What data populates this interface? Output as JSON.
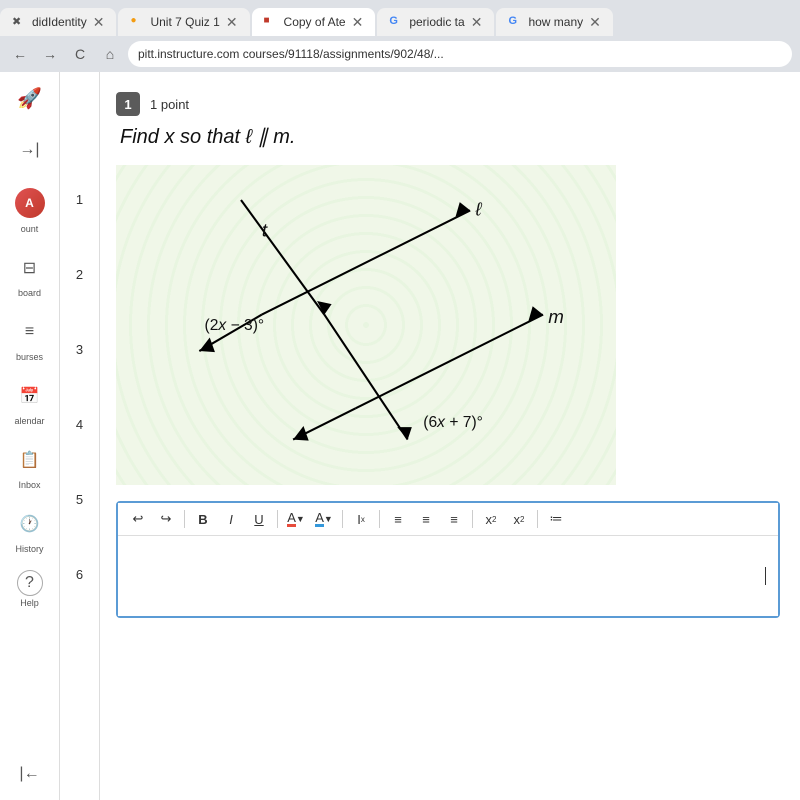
{
  "browser": {
    "tabs": [
      {
        "id": "tab1",
        "label": "didIdentity",
        "favicon_color": "#e74c3c",
        "active": false,
        "favicon": "✖"
      },
      {
        "id": "tab2",
        "label": "Unit 7 Quiz 1",
        "favicon_color": "#f39c12",
        "active": false,
        "favicon": "🟠"
      },
      {
        "id": "tab3",
        "label": "Copy of Ate",
        "favicon_color": "#c0392b",
        "active": true,
        "favicon": "🔴"
      },
      {
        "id": "tab4",
        "label": "periodic ta",
        "favicon_color": "#4285f4",
        "active": false,
        "favicon": "G"
      },
      {
        "id": "tab5",
        "label": "how many",
        "favicon_color": "#4285f4",
        "active": false,
        "favicon": "G"
      }
    ],
    "address": "pitt.instructure.com courses/91118/assignments/902/48/...",
    "nav_back": "←",
    "nav_forward": "→",
    "nav_refresh": "C",
    "nav_home": "⌂"
  },
  "sidebar": {
    "items": [
      {
        "id": "rocket",
        "icon": "🚀",
        "label": ""
      },
      {
        "id": "collapse",
        "icon": "→|",
        "label": ""
      },
      {
        "id": "account",
        "icon": "👤",
        "label": "ount"
      },
      {
        "id": "dashboard",
        "icon": "⊞",
        "label": "board"
      },
      {
        "id": "courses",
        "icon": "≡",
        "label": "burses"
      },
      {
        "id": "calendar",
        "icon": "📅",
        "label": "alendar"
      },
      {
        "id": "inbox",
        "icon": "📋",
        "label": "Inbox"
      },
      {
        "id": "history",
        "icon": "🕐",
        "label": "History"
      },
      {
        "id": "help",
        "icon": "?",
        "label": "Help"
      }
    ],
    "collapse_bottom": "←"
  },
  "number_sidebar": {
    "numbers": [
      "1",
      "2",
      "3",
      "4",
      "5",
      "6"
    ]
  },
  "question": {
    "number": "1",
    "points": "1 point",
    "text": "Find x so that ℓ ∥ m.",
    "diagram": {
      "label_t": "t",
      "label_l": "ℓ",
      "label_m": "m",
      "angle1": "(2x − 3)°",
      "angle2": "(6x + 7)°"
    }
  },
  "toolbar": {
    "undo": "↩",
    "redo": "↪",
    "bold": "B",
    "italic": "I",
    "underline": "U",
    "font_color_label": "A",
    "highlight_label": "A",
    "clear_format": "Ix",
    "align_left": "≡",
    "align_center": "≡",
    "align_right": "≡",
    "superscript": "x²",
    "subscript": "x₂",
    "list": "≔"
  },
  "colors": {
    "active_tab_bg": "#ffffff",
    "inactive_tab_bg": "#f0f0f0",
    "tab_bar_bg": "#dee1e6",
    "sidebar_bg": "#ffffff",
    "accent_blue": "#5b9bd5",
    "badge_dark": "#5b5b5b"
  }
}
